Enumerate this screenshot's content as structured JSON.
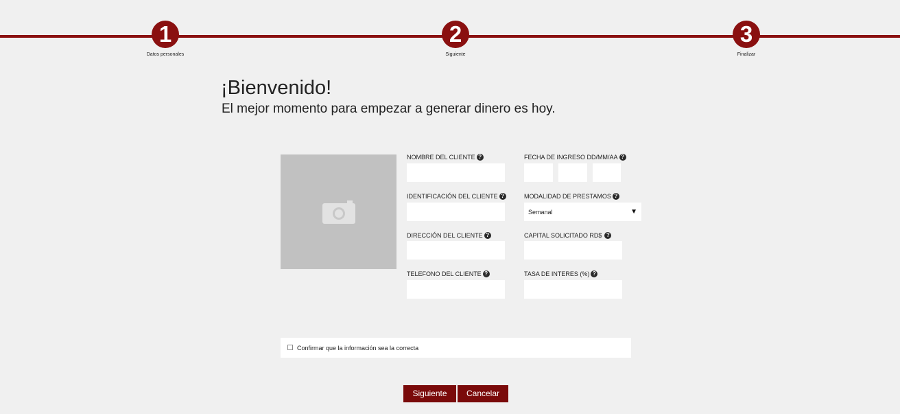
{
  "stepper": {
    "steps": [
      {
        "number": "1",
        "label": "Datos personales"
      },
      {
        "number": "2",
        "label": "Siguiente"
      },
      {
        "number": "3",
        "label": "Finalizar"
      }
    ]
  },
  "header": {
    "title": "¡Bienvenido!",
    "subtitle": "El mejor momento para empezar a generar dinero es hoy."
  },
  "photo": {
    "icon": "camera-icon"
  },
  "form": {
    "nombre_label": "NOMBRE DEL CLIENTE",
    "identificacion_label": "IDENTIFICACIÓN DEL CLIENTE",
    "direccion_label": "DIRECCIÓN DEL CLIENTE",
    "telefono_label": "TELEFONO DEL CLIENTE",
    "fecha_label": "FECHA DE INGRESO DD/MM/AA",
    "modalidad_label": "MODALIDAD DE PRESTAMOS",
    "modalidad_value": "Semanal",
    "capital_label": "CAPITAL SOLICITADO RD$",
    "tasa_label": "TASA DE INTERES (%)",
    "help_glyph": "?"
  },
  "confirm": {
    "label": "Confirmar que la información sea la correcta"
  },
  "buttons": {
    "next": "Siguiente",
    "cancel": "Cancelar"
  },
  "colors": {
    "accent": "#8a1010",
    "button": "#7a0a0a",
    "background": "#f0f0f0"
  }
}
